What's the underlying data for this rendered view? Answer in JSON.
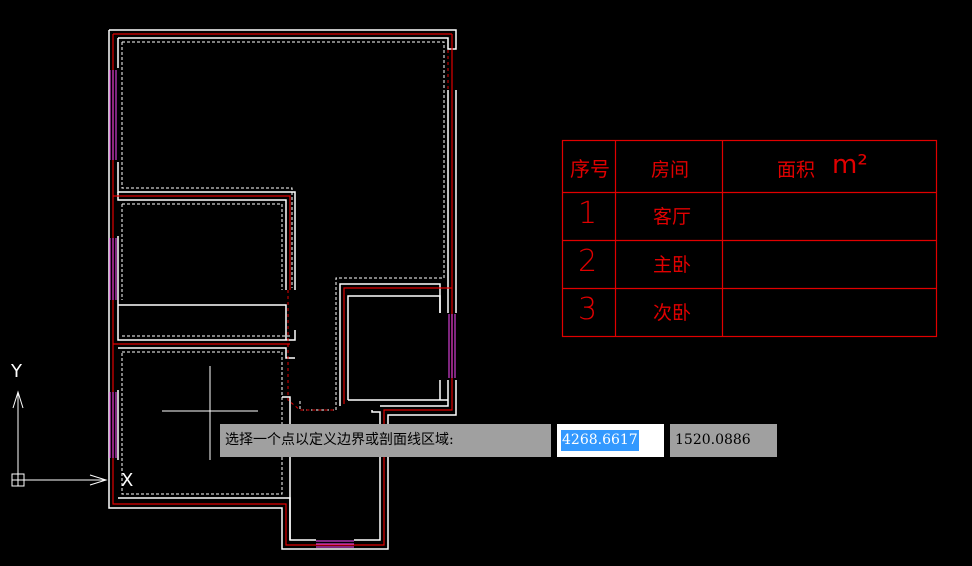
{
  "table": {
    "header": {
      "col_number": "序号",
      "col_room": "房间",
      "col_area": "面积",
      "col_area_unit": "m²"
    },
    "rows": [
      {
        "number": "1",
        "room": "客厅",
        "area": ""
      },
      {
        "number": "2",
        "room": "主卧",
        "area": ""
      },
      {
        "number": "3",
        "room": "次卧",
        "area": ""
      }
    ]
  },
  "command": {
    "prompt": "选择一个点以定义边界或剖面线区域:",
    "x_value": "4268.6617",
    "y_value": "1520.0886"
  },
  "ucs": {
    "y_label": "Y",
    "x_label": "X"
  },
  "colors": {
    "background": "#000000",
    "wall": "#ffffff",
    "wall_inner": "#e00000",
    "window": "#d040d0",
    "table_line": "#e00000",
    "selection": "#3399ff"
  }
}
